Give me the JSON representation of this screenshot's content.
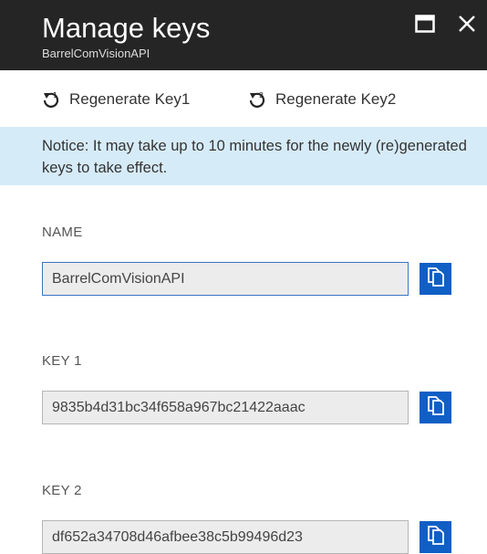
{
  "header": {
    "title": "Manage keys",
    "subtitle": "BarrelComVisionAPI"
  },
  "toolbar": {
    "regenerate_key1": "Regenerate Key1",
    "regenerate_key2": "Regenerate Key2"
  },
  "notice": {
    "text": "Notice: It may take up to 10 minutes for the newly (re)generated keys to take effect."
  },
  "fields": {
    "name": {
      "label": "NAME",
      "value": "BarrelComVisionAPI"
    },
    "key1": {
      "label": "KEY 1",
      "value": "9835b4d31bc34f658a967bc21422aaac"
    },
    "key2": {
      "label": "KEY 2",
      "value": "df652a34708d46afbee38c5b99496d23"
    }
  },
  "colors": {
    "header_bg": "#252525",
    "notice_bg": "#d6ebf8",
    "copy_button": "#0f5fc5",
    "field_bg": "#ececec",
    "focus_border": "#3a74c4"
  },
  "icons": {
    "maximize": "maximize-icon",
    "close": "close-icon",
    "regenerate": "refresh-icon",
    "copy": "copy-icon"
  }
}
